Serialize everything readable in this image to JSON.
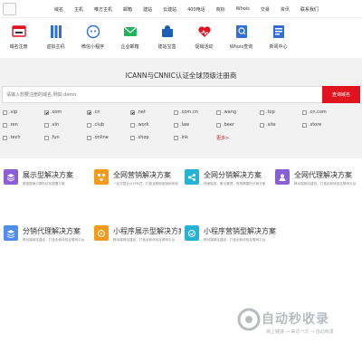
{
  "nav": {
    "items": [
      "域名",
      "主机",
      "唯方主机",
      "邮箱",
      "建站",
      "云建站",
      "400电话",
      "商标",
      "Whois",
      "交易",
      "资讯",
      "联系我们"
    ]
  },
  "services": [
    {
      "label": "域名注册",
      "icon": "domain-icon",
      "color": "#e0141e"
    },
    {
      "label": "虚拟主机",
      "icon": "server-icon",
      "color": "#2e6fd8"
    },
    {
      "label": "微信小程序",
      "icon": "wechat-icon",
      "color": "#2e6fd8"
    },
    {
      "label": "企业邮箱",
      "icon": "mail-icon",
      "color": "#1fb35a"
    },
    {
      "label": "建站宝盒",
      "icon": "box-icon",
      "color": "#1c5fb8"
    },
    {
      "label": "促销活动",
      "icon": "heart-icon",
      "color": "#e0141e"
    },
    {
      "label": "Whois查询",
      "icon": "search-doc-icon",
      "color": "#2e6fd8"
    },
    {
      "label": "新闻中心",
      "icon": "news-icon",
      "color": "#2e6fd8"
    }
  ],
  "banner": {
    "title": "ICANN与CNNIC认证全球顶级注册商",
    "search_placeholder": "请输入想要注册的域名,例如 demo",
    "search_button": "查询域名"
  },
  "tlds": [
    {
      "name": ".vip",
      "checked": false
    },
    {
      "name": ".com",
      "checked": true
    },
    {
      "name": ".cn",
      "checked": true
    },
    {
      "name": ".net",
      "checked": true
    },
    {
      "name": ".com.cn",
      "checked": false
    },
    {
      "name": ".wang",
      "checked": false
    },
    {
      "name": ".top",
      "checked": false
    },
    {
      "name": ".cn.com",
      "checked": false
    },
    {
      "name": ".ren",
      "checked": false
    },
    {
      "name": ".xin",
      "checked": false
    },
    {
      "name": ".club",
      "checked": false
    },
    {
      "name": ".work",
      "checked": false
    },
    {
      "name": ".law",
      "checked": false
    },
    {
      "name": ".beer",
      "checked": false
    },
    {
      "name": ".site",
      "checked": false
    },
    {
      "name": ".store",
      "checked": false
    },
    {
      "name": ".tech",
      "checked": false
    },
    {
      "name": ".fun",
      "checked": false
    },
    {
      "name": ".online",
      "checked": false
    },
    {
      "name": ".shop",
      "checked": false
    },
    {
      "name": ".ink",
      "checked": false
    }
  ],
  "more_label": "更多>",
  "cards": [
    {
      "title": "展示型解决方案",
      "desc": "覆盖搜索引擎的优化配置方案",
      "color": "#8a5fd6",
      "icon": "layers-icon"
    },
    {
      "title": "全网营销解决方案",
      "desc": "一站式整合分分布式，打造互联网营销新体验",
      "color": "#f39a1c",
      "icon": "network-icon"
    },
    {
      "title": "全网分销解决方案",
      "desc": "快速裂变，集中管理，有限需要的分销方案",
      "color": "#27b3d6",
      "icon": "share-icon"
    },
    {
      "title": "全网代理解决方案",
      "desc": "移动端网站建设，打造全新体验互联网平台",
      "color": "#8a5fd6",
      "icon": "agent-icon"
    },
    {
      "title": "分销代理解决方案",
      "desc": "移动端网站建设，打造全新体验互联网平台",
      "color": "#4f8df0",
      "icon": "stack-icon"
    },
    {
      "title": "小程序展示型解决方案",
      "desc": "移动端网站建设，打造全新体验互联网平台",
      "color": "#f39a1c",
      "icon": "miniapp-icon"
    },
    {
      "title": "小程序营销型解决方案",
      "desc": "移动端网站建设，打造全新体验互联网平台",
      "color": "#27b3d6",
      "icon": "miniapp-sales-icon"
    }
  ],
  "watermark": {
    "text": "自动秒收录",
    "sub": "做上链接 → 来访一次 → 自动收录"
  }
}
